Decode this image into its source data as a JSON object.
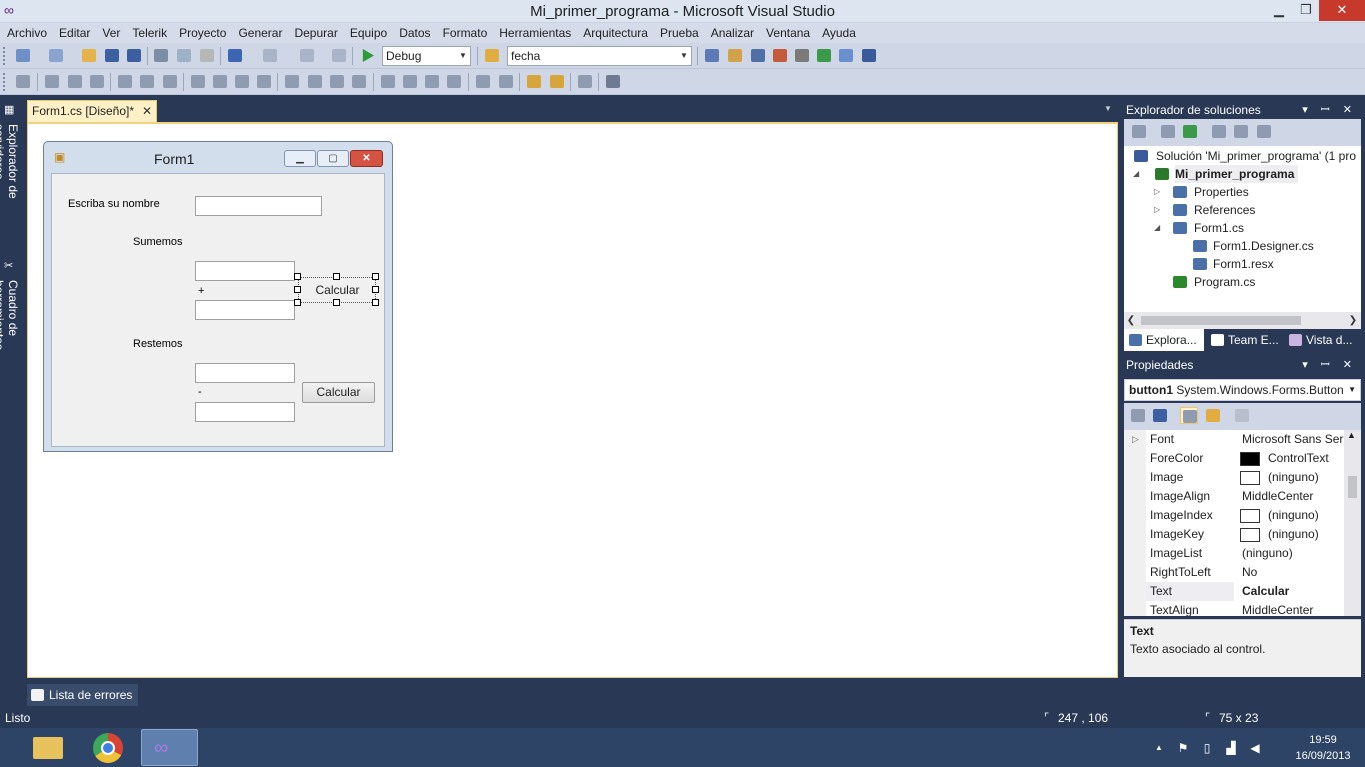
{
  "window": {
    "title": "Mi_primer_programa - Microsoft Visual Studio",
    "min_glyph": "▁",
    "max_glyph": "❐",
    "close_glyph": "✕"
  },
  "menu": [
    "Archivo",
    "Editar",
    "Ver",
    "Telerik",
    "Proyecto",
    "Generar",
    "Depurar",
    "Equipo",
    "Datos",
    "Formato",
    "Herramientas",
    "Arquitectura",
    "Prueba",
    "Analizar",
    "Ventana",
    "Ayuda"
  ],
  "toolbar": {
    "config_value": "Debug",
    "find_value": "fecha"
  },
  "left_rail": {
    "server_explorer": "Explorador de servidores",
    "toolbox": "Cuadro de herramientas"
  },
  "doc_tab": {
    "label": "Form1.cs [Diseño]*",
    "close": "✕"
  },
  "form": {
    "title": "Form1",
    "label_name": "Escriba su nombre",
    "label_sum": "Sumemos",
    "plus": "+",
    "button_sum": "Calcular",
    "label_sub": "Restemos",
    "minus": "-",
    "button_sub": "Calcular"
  },
  "solution_explorer": {
    "title": "Explorador de soluciones",
    "pin_buttons": "▾ ꟷ ✕",
    "items": [
      {
        "label": "Solución 'Mi_primer_programa'  (1 pro",
        "color": "#3b5a9a"
      },
      {
        "label": "Mi_primer_programa",
        "color": "#2a7a2a",
        "bold": true
      },
      {
        "label": "Properties",
        "color": "#4b6fa8"
      },
      {
        "label": "References",
        "color": "#4b6fa8"
      },
      {
        "label": "Form1.cs",
        "color": "#4b6fa8"
      },
      {
        "label": "Form1.Designer.cs",
        "color": "#4b6fa8"
      },
      {
        "label": "Form1.resx",
        "color": "#4b6fa8"
      },
      {
        "label": "Program.cs",
        "color": "#2a8a2a"
      }
    ],
    "tabs": [
      "Explora...",
      "Team E...",
      "Vista d..."
    ]
  },
  "properties": {
    "title": "Propiedades",
    "object_name": "button1",
    "object_type": "System.Windows.Forms.Button",
    "rows": [
      {
        "name": "Font",
        "value": "Microsoft Sans Seri",
        "expandable": true
      },
      {
        "name": "ForeColor",
        "value": "ControlText",
        "swatch": "#000000"
      },
      {
        "name": "Image",
        "value": "(ninguno)",
        "swatch": "#ffffff"
      },
      {
        "name": "ImageAlign",
        "value": "MiddleCenter"
      },
      {
        "name": "ImageIndex",
        "value": "(ninguno)",
        "swatch": "#ffffff"
      },
      {
        "name": "ImageKey",
        "value": "(ninguno)",
        "swatch": "#ffffff"
      },
      {
        "name": "ImageList",
        "value": "(ninguno)"
      },
      {
        "name": "RightToLeft",
        "value": "No"
      },
      {
        "name": "Text",
        "value": "Calcular",
        "bold": true,
        "selected": true
      },
      {
        "name": "TextAlign",
        "value": "MiddleCenter"
      }
    ],
    "desc_title": "Text",
    "desc_text": "Texto asociado al control."
  },
  "bottom": {
    "error_list": "Lista de errores"
  },
  "status": {
    "text": "Listo",
    "position": "247 , 106",
    "size": "75 x 23"
  },
  "taskbar": {
    "time": "19:59",
    "date": "16/09/2013"
  }
}
